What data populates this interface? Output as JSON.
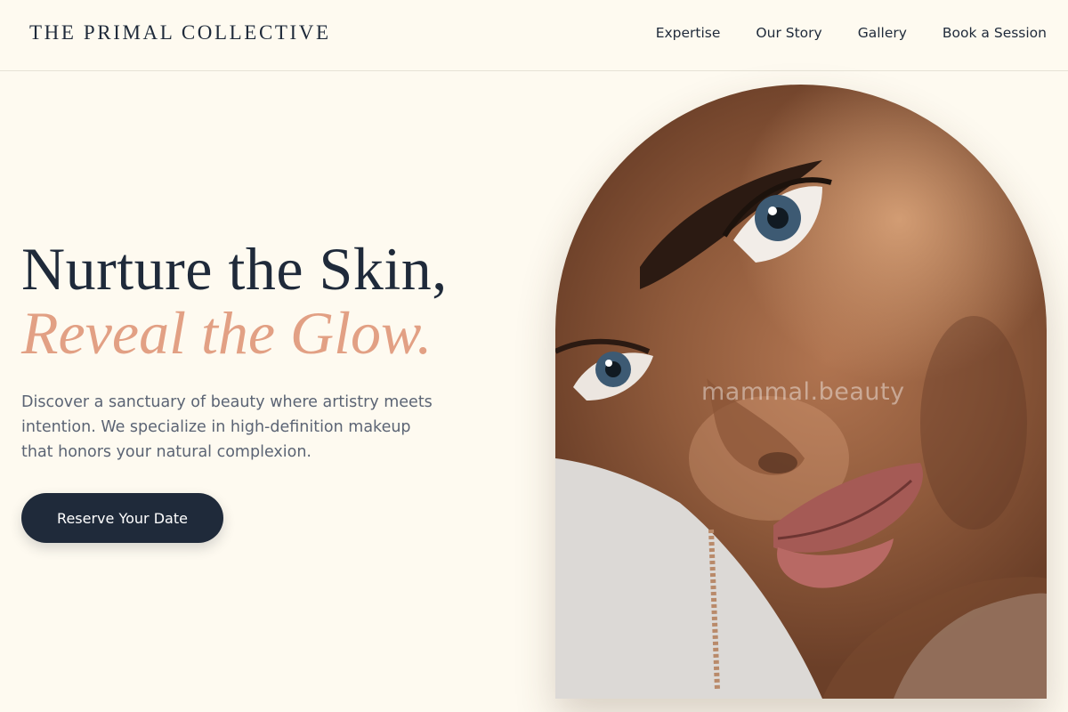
{
  "header": {
    "brand": "THE PRIMAL COLLECTIVE",
    "nav": [
      {
        "label": "Expertise"
      },
      {
        "label": "Our Story"
      },
      {
        "label": "Gallery"
      },
      {
        "label": "Book a Session"
      }
    ]
  },
  "hero": {
    "headline_line1": "Nurture the Skin,",
    "headline_line2": "Reveal the Glow.",
    "intro": "Discover a sanctuary of beauty where artistry meets intention. We specialize in high-definition makeup that honors your natural complexion.",
    "cta_label": "Reserve Your Date"
  },
  "portrait": {
    "watermark": "mammal.beauty"
  },
  "colors": {
    "background": "#fefaf0",
    "navy": "#1f2a3a",
    "accent": "#e2a084",
    "body_text": "#5b6474"
  }
}
